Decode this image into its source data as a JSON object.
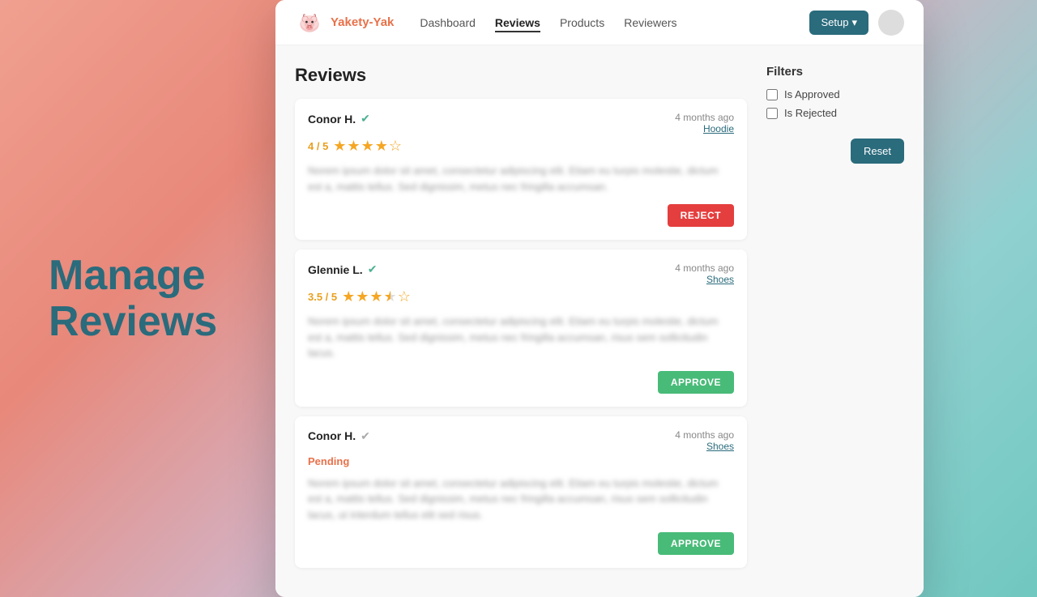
{
  "leftText": {
    "line1": "Manage",
    "line2": "Reviews"
  },
  "navbar": {
    "brand": "Yakety-Yak",
    "links": [
      {
        "label": "Dashboard",
        "active": false
      },
      {
        "label": "Reviews",
        "active": true
      },
      {
        "label": "Products",
        "active": false
      },
      {
        "label": "Reviewers",
        "active": false
      }
    ],
    "setup_label": "Setup",
    "setup_arrow": "▾"
  },
  "page_title": "Reviews",
  "filters": {
    "title": "Filters",
    "items": [
      {
        "label": "Is Approved",
        "checked": false
      },
      {
        "label": "Is Rejected",
        "checked": false
      }
    ],
    "reset_label": "Reset"
  },
  "reviews": [
    {
      "reviewer": "Conor H.",
      "verified": true,
      "time": "4 months ago",
      "product": "Hoodie",
      "rating_text": "4 / 5",
      "stars": 4,
      "half": false,
      "status": "approved",
      "body": "Norem ipsum dolor sit amet, consectetur adipiscing elit. Etiam eu turpis molestie, dictum est a, mattis tellus. Sed dignissim, metus nec fringilla accumsan.",
      "action": "REJECT",
      "action_type": "reject"
    },
    {
      "reviewer": "Glennie L.",
      "verified": true,
      "time": "4 months ago",
      "product": "Shoes",
      "rating_text": "3.5 / 5",
      "stars": 3,
      "half": true,
      "status": "approved",
      "body": "Norem ipsum dolor sit amet, consectetur adipiscing elit. Etiam eu turpis molestie, dictum est a, mattis tellus. Sed dignissim, metus nec fringilla accumsan, risus sem sollicitudin lacus.",
      "action": "APPROVE",
      "action_type": "approve"
    },
    {
      "reviewer": "Conor H.",
      "verified": true,
      "time": "4 months ago",
      "product": "Shoes",
      "rating_text": "Pending",
      "stars": 0,
      "half": false,
      "status": "pending",
      "body": "Norem ipsum dolor sit amet, consectetur adipiscing elit. Etiam eu turpis molestie, dictum est a, mattis tellus. Sed dignissim, metus nec fringilla accumsan, risus sem sollicitudin lacus, ut interdum tellus elit sed risus.",
      "action": "APPROVE",
      "action_type": "approve"
    }
  ]
}
